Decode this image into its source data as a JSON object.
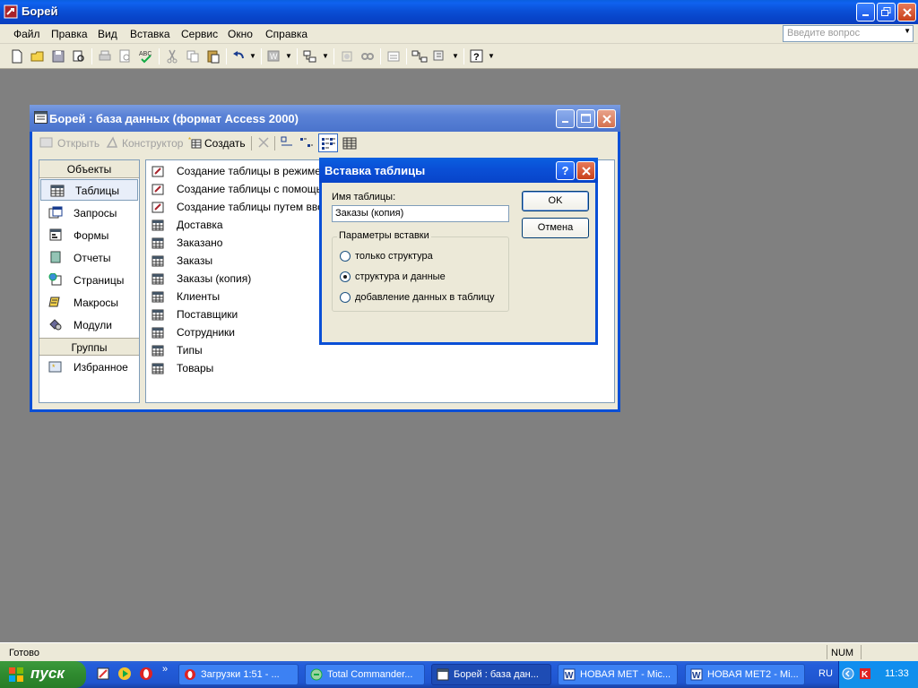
{
  "app": {
    "title": "Борей"
  },
  "menu": {
    "items": [
      "Файл",
      "Правка",
      "Вид",
      "Вставка",
      "Сервис",
      "Окно",
      "Справка"
    ],
    "ask_placeholder": "Введите вопрос"
  },
  "db_window": {
    "title": "Борей : база данных (формат Access 2000)",
    "toolbar": {
      "open": "Открыть",
      "design": "Конструктор",
      "create": "Создать"
    },
    "objects_header": "Объекты",
    "objects": [
      "Таблицы",
      "Запросы",
      "Формы",
      "Отчеты",
      "Страницы",
      "Макросы",
      "Модули"
    ],
    "groups_header": "Группы",
    "groups": [
      "Избранное"
    ],
    "list": [
      "Создание таблицы в режиме ко",
      "Создание таблицы с помощью м",
      "Создание таблицы путем вводa",
      "Доставка",
      "Заказано",
      "Заказы",
      "Заказы (копия)",
      "Клиенты",
      "Поставщики",
      "Сотрудники",
      "Типы",
      "Товары"
    ]
  },
  "dialog": {
    "title": "Вставка таблицы",
    "name_label": "Имя таблицы:",
    "name_value": "Заказы (копия)",
    "group_label": "Параметры вставки",
    "options": [
      "только структура",
      "структура и данные",
      "добавление данных в таблицу"
    ],
    "selected_option": 1,
    "ok": "OK",
    "cancel": "Отмена"
  },
  "status": {
    "text": "Готово",
    "num": "NUM"
  },
  "taskbar": {
    "start": "пуск",
    "tasks": [
      "Загрузки 1:51 - ...",
      "Total Commander...",
      "Борей : база дан...",
      "НОВАЯ МЕТ - Mic...",
      "НОВАЯ МЕТ2 - Mi..."
    ],
    "lang": "RU",
    "clock": "11:33"
  }
}
